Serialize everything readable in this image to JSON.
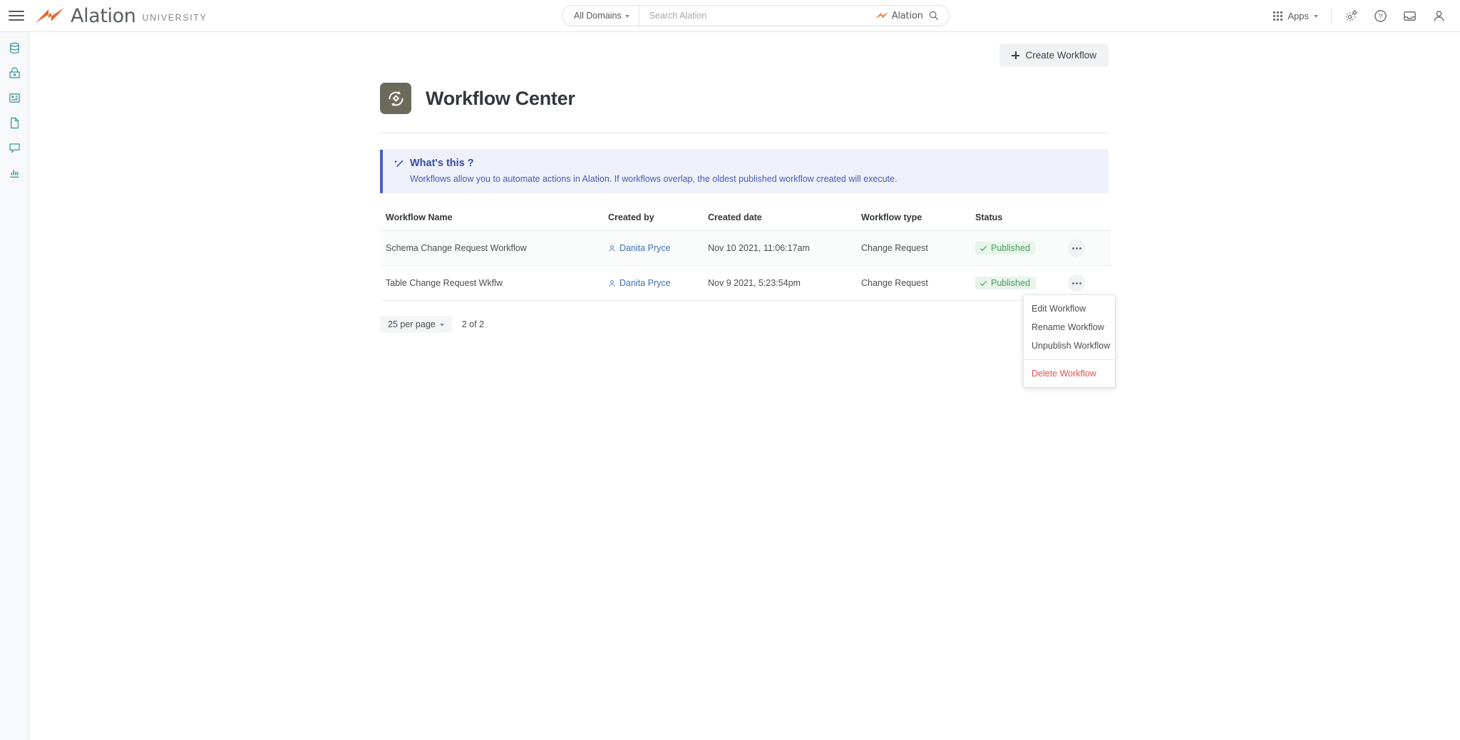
{
  "brand": {
    "name": "Alation",
    "sub": "UNIVERSITY",
    "logo_icon": "alation-bowtie-logo",
    "menu_icon": "hamburger-menu-icon",
    "accent": "#e8682c"
  },
  "search": {
    "domain_label": "All Domains",
    "placeholder": "Search Alation",
    "value": "",
    "inline_brand": "Alation",
    "search_icon": "search-icon",
    "caret_icon": "chevron-down-icon"
  },
  "topnav": {
    "apps_label": "Apps",
    "apps_icon": "apps-grid-icon",
    "apps_caret": "caret-down-icon",
    "icons": [
      {
        "name": "settings-gears-icon",
        "glyph": "gears"
      },
      {
        "name": "help-circle-icon",
        "glyph": "question"
      },
      {
        "name": "inbox-icon",
        "glyph": "inbox"
      },
      {
        "name": "user-account-icon",
        "glyph": "person"
      }
    ]
  },
  "sidebar": {
    "accent": "#3f9aa0",
    "items": [
      {
        "name": "sidebar-item-data-sources",
        "icon": "database-icon"
      },
      {
        "name": "sidebar-item-catalog",
        "icon": "lock-archive-icon"
      },
      {
        "name": "sidebar-item-queries",
        "icon": "table-grid-icon"
      },
      {
        "name": "sidebar-item-articles",
        "icon": "document-icon"
      },
      {
        "name": "sidebar-item-conversations",
        "icon": "chat-bubble-icon"
      },
      {
        "name": "sidebar-item-analytics",
        "icon": "bar-chart-icon"
      }
    ]
  },
  "page": {
    "create_label": "Create Workflow",
    "title": "Workflow Center",
    "title_icon": "workflow-sync-icon",
    "title_icon_bg": "#6b6b5c"
  },
  "banner": {
    "icon": "magic-wand-icon",
    "title": "What's this ?",
    "text": "Workflows allow you to automate actions in Alation. If workflows overlap, the oldest published workflow created will execute.",
    "accent": "#4a5fc1",
    "background": "#eef1fa"
  },
  "table": {
    "columns": [
      "Workflow Name",
      "Created by",
      "Created date",
      "Workflow type",
      "Status"
    ],
    "rows": [
      {
        "name": "Schema Change Request Workflow",
        "created_by": "Danita Pryce",
        "created_date": "Nov 10 2021, 11:06:17am",
        "type": "Change Request",
        "status": "Published",
        "status_color": "#4a9a5e"
      },
      {
        "name": "Table Change Request Wkflw",
        "created_by": "Danita Pryce",
        "created_date": "Nov 9 2021, 5:23:54pm",
        "type": "Change Request",
        "status": "Published",
        "status_color": "#4a9a5e"
      }
    ],
    "row_menu_icon": "more-options-icon",
    "user_icon": "person-icon",
    "status_icon": "check-icon"
  },
  "pagination": {
    "per_page_label": "25 per page",
    "count_label": "2 of 2",
    "next_icon": "chevron-right-icon",
    "caret_icon": "chevron-down-icon"
  },
  "context_menu": {
    "items": [
      {
        "label": "Edit Workflow",
        "danger": false
      },
      {
        "label": "Rename Workflow",
        "danger": false
      },
      {
        "label": "Unpublish Workflow",
        "danger": false
      }
    ],
    "danger_item": {
      "label": "Delete Workflow",
      "color": "#d9534f"
    }
  }
}
